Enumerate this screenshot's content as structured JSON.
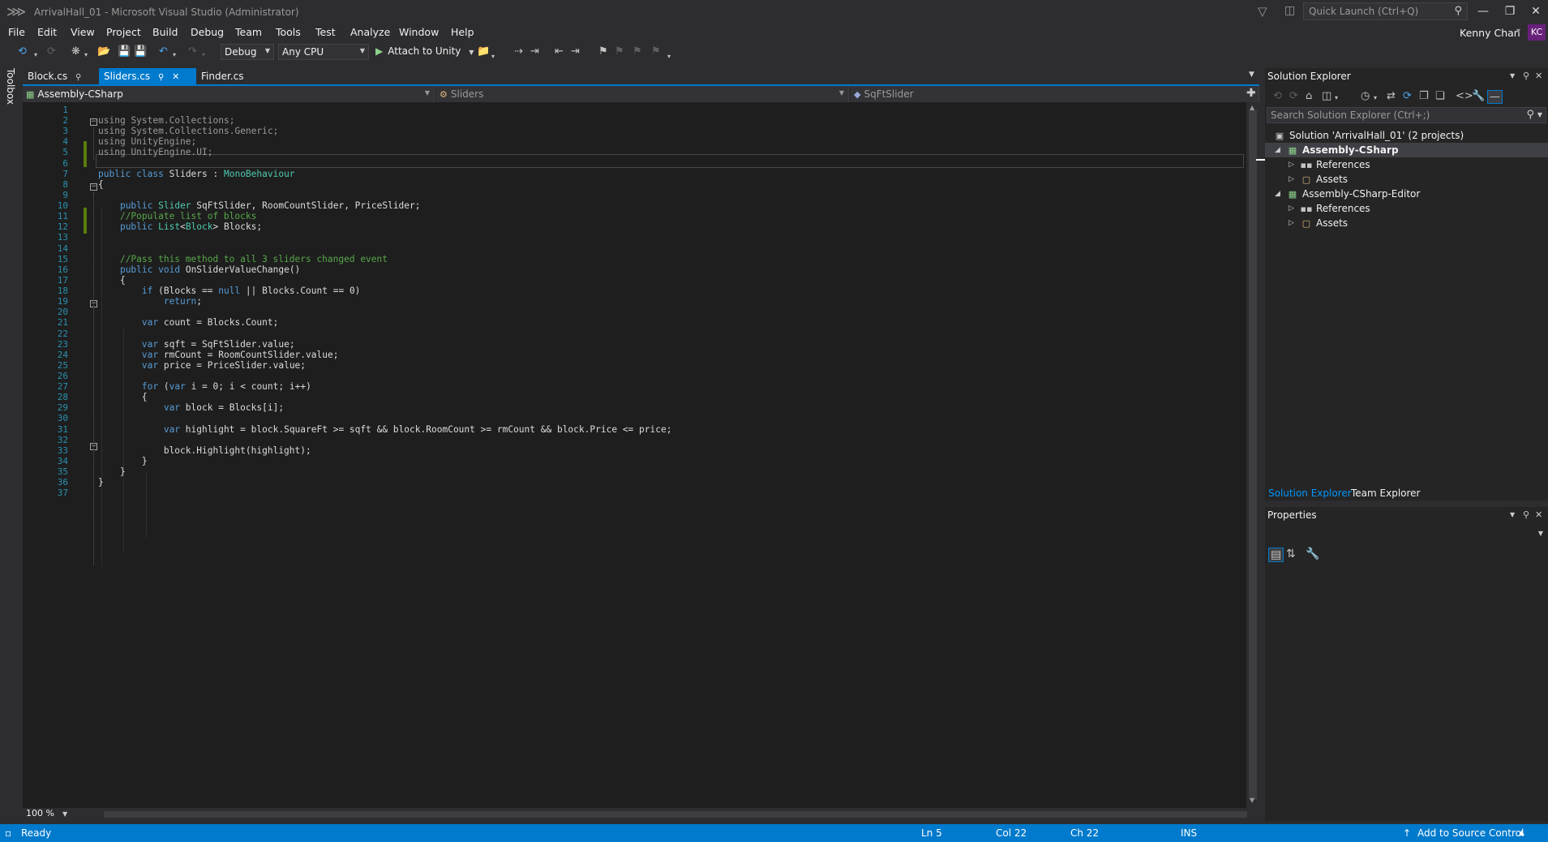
{
  "window": {
    "title": "ArrivalHall_01 - Microsoft Visual Studio  (Administrator)",
    "quick_launch_placeholder": "Quick Launch (Ctrl+Q)",
    "user_name": "Kenny Chan",
    "user_initials": "KC"
  },
  "menu": [
    "File",
    "Edit",
    "View",
    "Project",
    "Build",
    "Debug",
    "Team",
    "Tools",
    "Test",
    "Analyze",
    "Window",
    "Help"
  ],
  "toolbar": {
    "configuration": "Debug",
    "platform": "Any CPU",
    "attach_label": "Attach to Unity"
  },
  "toolbox_label": "Toolbox",
  "editor_tabs": [
    {
      "label": "Block.cs",
      "active": false
    },
    {
      "label": "Sliders.cs",
      "active": true
    },
    {
      "label": "Finder.cs",
      "active": false
    }
  ],
  "navbar": {
    "project": "Assembly-CSharp",
    "type": "Sliders",
    "member": "SqFtSlider"
  },
  "code_lines": [
    "",
    "using System.Collections;",
    "using System.Collections.Generic;",
    "using UnityEngine;",
    "using UnityEngine.UI;",
    "",
    "public class Sliders : MonoBehaviour",
    "{",
    "",
    "    public Slider SqFtSlider, RoomCountSlider, PriceSlider;",
    "    //Populate list of blocks",
    "    public List<Block> Blocks;",
    "",
    "",
    "    //Pass this method to all 3 sliders changed event",
    "    public void OnSliderValueChange()",
    "    {",
    "        if (Blocks == null || Blocks.Count == 0)",
    "            return;",
    "",
    "        var count = Blocks.Count;",
    "",
    "        var sqft = SqFtSlider.value;",
    "        var rmCount = RoomCountSlider.value;",
    "        var price = PriceSlider.value;",
    "",
    "        for (var i = 0; i < count; i++)",
    "        {",
    "            var block = Blocks[i];",
    "",
    "            var highlight = block.SquareFt >= sqft && block.RoomCount >= rmCount && block.Price <= price;",
    "",
    "            block.Highlight(highlight);",
    "        }",
    "    }",
    "}",
    ""
  ],
  "zoom": "100 %",
  "solution_explorer": {
    "title": "Solution Explorer",
    "search_placeholder": "Search Solution Explorer (Ctrl+;)",
    "tree": [
      {
        "label": "Solution 'ArrivalHall_01' (2 projects)",
        "icon": "solution-icon",
        "level": 0,
        "expander": ""
      },
      {
        "label": "Assembly-CSharp",
        "icon": "csharp-project-icon",
        "level": 1,
        "expander": "expanded",
        "selected": true
      },
      {
        "label": "References",
        "icon": "references-icon",
        "level": 2,
        "expander": "collapsed"
      },
      {
        "label": "Assets",
        "icon": "folder-icon",
        "level": 2,
        "expander": "collapsed"
      },
      {
        "label": "Assembly-CSharp-Editor",
        "icon": "csharp-project-icon",
        "level": 1,
        "expander": "expanded"
      },
      {
        "label": "References",
        "icon": "references-icon",
        "level": 2,
        "expander": "collapsed"
      },
      {
        "label": "Assets",
        "icon": "folder-icon",
        "level": 2,
        "expander": "collapsed"
      }
    ],
    "tabs": [
      "Solution Explorer",
      "Team Explorer"
    ]
  },
  "properties": {
    "title": "Properties"
  },
  "status": {
    "ready": "Ready",
    "line": "Ln 5",
    "col": "Col 22",
    "ch": "Ch 22",
    "mode": "INS",
    "source_control": "Add to Source Control"
  }
}
